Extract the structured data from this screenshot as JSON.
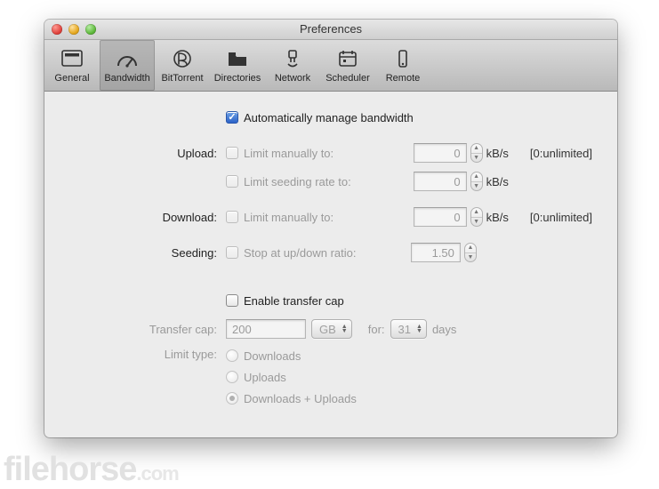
{
  "window": {
    "title": "Preferences"
  },
  "toolbar": {
    "items": [
      {
        "label": "General"
      },
      {
        "label": "Bandwidth"
      },
      {
        "label": "BitTorrent"
      },
      {
        "label": "Directories"
      },
      {
        "label": "Network"
      },
      {
        "label": "Scheduler"
      },
      {
        "label": "Remote"
      }
    ]
  },
  "form": {
    "auto_label": "Automatically manage bandwidth",
    "upload_label": "Upload:",
    "upload_limit_label": "Limit manually to:",
    "upload_limit_value": "0",
    "upload_unit": "kB/s",
    "upload_hint": "[0:unlimited]",
    "seeding_rate_label": "Limit seeding rate to:",
    "seeding_rate_value": "0",
    "seeding_rate_unit": "kB/s",
    "download_label": "Download:",
    "download_limit_label": "Limit manually to:",
    "download_limit_value": "0",
    "download_unit": "kB/s",
    "download_hint": "[0:unlimited]",
    "seeding_label": "Seeding:",
    "seeding_stop_label": "Stop at up/down ratio:",
    "seeding_stop_value": "1.50",
    "enable_cap_label": "Enable transfer cap",
    "transfer_cap_label": "Transfer cap:",
    "transfer_cap_value": "200",
    "transfer_cap_unit": "GB",
    "for_label": "for:",
    "for_value": "31",
    "days_label": "days",
    "limit_type_label": "Limit type:",
    "limit_types": [
      "Downloads",
      "Uploads",
      "Downloads + Uploads"
    ]
  },
  "watermark": {
    "a": "filehorse",
    "b": ".com"
  }
}
